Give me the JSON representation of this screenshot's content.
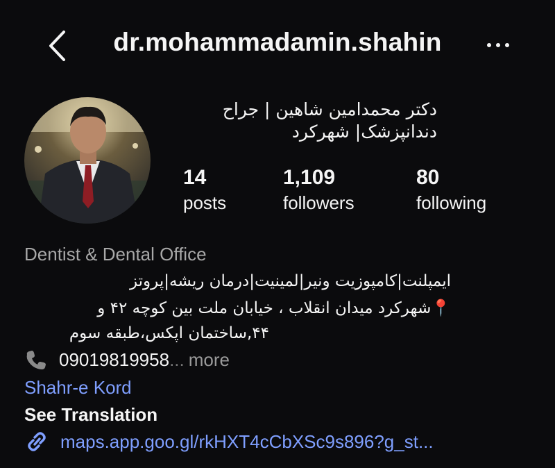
{
  "header": {
    "username": "dr.mohammadamin.shahin",
    "back_icon": "chevron-left-icon",
    "more_icon": "more-horizontal-icon"
  },
  "profile": {
    "full_name_line1": "دکتر محمدامین شاهین | جراح",
    "full_name_line2": "دندانپزشک| شهرکرد",
    "stats": [
      {
        "value": "14",
        "label": "posts"
      },
      {
        "value": "1,109",
        "label": "followers"
      },
      {
        "value": "80",
        "label": "following"
      }
    ]
  },
  "bio": {
    "category": "Dentist & Dental Office",
    "line1": "ایمپلنت|کامپوزیت ونیر|لمینیت|درمان ریشه|پروتز",
    "line2": "📍شهرکرد میدان انقلاب ، خیابان ملت بین کوچه ۴۲ و",
    "line3": "۴۴,ساختمان اپکس،طبقه سوم",
    "phone_icon": "phone-icon",
    "phone": "09019819958",
    "ellipsis": "...",
    "more": "more",
    "city": "Shahr-e Kord",
    "see_translation": "See Translation",
    "link_icon": "link-icon",
    "link": "maps.app.goo.gl/rkHXT4cCbXSc9s896?g_st..."
  },
  "colors": {
    "background": "#0b0b0d",
    "text": "#f5f5f5",
    "muted": "#a8a8a8",
    "link": "#7f9fff"
  }
}
